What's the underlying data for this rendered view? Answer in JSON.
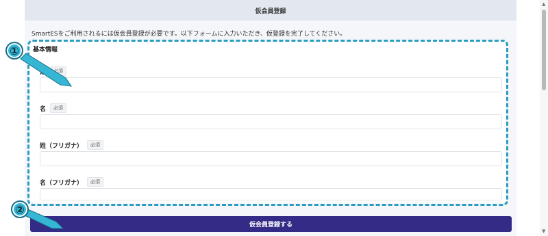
{
  "header": {
    "title": "仮会員登録"
  },
  "intro": "SmartESをご利用されるには仮会員登録が必要です。以下フォームに入力いただき、仮登録を完了してください。",
  "section": {
    "title": "基本情報"
  },
  "required_label": "必須",
  "fields": [
    {
      "label": "姓",
      "value": ""
    },
    {
      "label": "名",
      "value": ""
    },
    {
      "label": "姓（フリガナ）",
      "value": ""
    },
    {
      "label": "名（フリガナ）",
      "value": ""
    }
  ],
  "submit_label": "仮会員登録する",
  "annotations": {
    "one": "①",
    "two": "②"
  },
  "colors": {
    "accent": "#332b86",
    "annotation": "#35b6d4",
    "dashed_border": "#2a9dbf"
  }
}
